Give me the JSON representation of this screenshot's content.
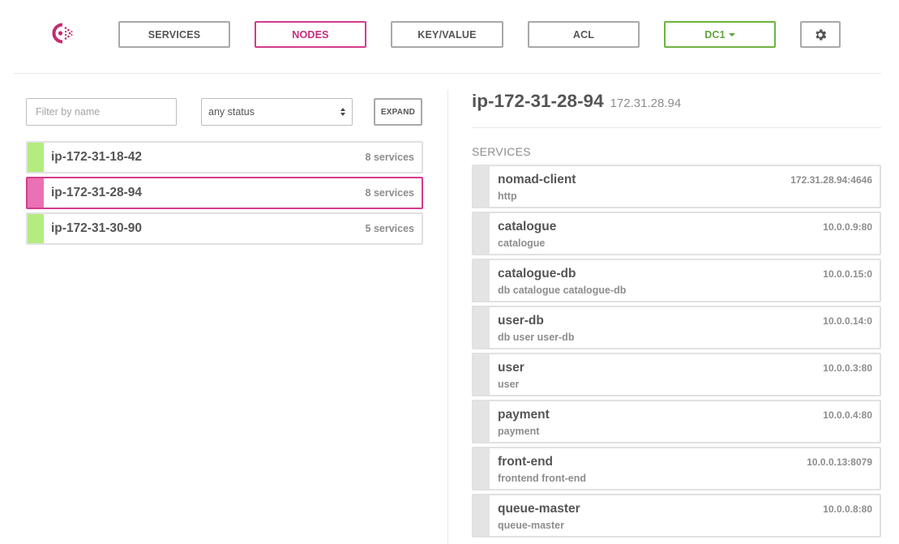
{
  "nav": {
    "logo_icon": "consul-logo-icon",
    "items": [
      {
        "label": "SERVICES",
        "active": false
      },
      {
        "label": "NODES",
        "active": true
      },
      {
        "label": "KEY/VALUE",
        "active": false
      },
      {
        "label": "ACL",
        "active": false
      }
    ],
    "datacenter": "DC1",
    "settings_icon": "gear-icon",
    "colors": {
      "active": "#d43b8c",
      "datacenter": "#6fb343",
      "border": "#a9a9a9"
    }
  },
  "filters": {
    "name_placeholder": "Filter by name",
    "name_value": "",
    "status_selected": "any status",
    "expand_label": "EXPAND"
  },
  "nodes": [
    {
      "name": "ip-172-31-18-42",
      "services": "8 services",
      "status": "passing",
      "selected": false
    },
    {
      "name": "ip-172-31-28-94",
      "services": "8 services",
      "status": "passing",
      "selected": true
    },
    {
      "name": "ip-172-31-30-90",
      "services": "5 services",
      "status": "passing",
      "selected": false
    }
  ],
  "detail": {
    "node_name": "ip-172-31-28-94",
    "node_address": "172.31.28.94",
    "services_label": "SERVICES",
    "services": [
      {
        "name": "nomad-client",
        "tags": "http",
        "address": "172.31.28.94:4646"
      },
      {
        "name": "catalogue",
        "tags": "catalogue",
        "address": "10.0.0.9:80"
      },
      {
        "name": "catalogue-db",
        "tags": "db catalogue catalogue-db",
        "address": "10.0.0.15:0"
      },
      {
        "name": "user-db",
        "tags": "db user user-db",
        "address": "10.0.0.14:0"
      },
      {
        "name": "user",
        "tags": "user",
        "address": "10.0.0.3:80"
      },
      {
        "name": "payment",
        "tags": "payment",
        "address": "10.0.0.4:80"
      },
      {
        "name": "front-end",
        "tags": "frontend front-end",
        "address": "10.0.0.13:8079"
      },
      {
        "name": "queue-master",
        "tags": "queue-master",
        "address": "10.0.0.8:80"
      }
    ]
  },
  "colors": {
    "passing": "#b5ec7f",
    "selected": "#ea71b3",
    "service_bar": "#e4e4e4"
  }
}
